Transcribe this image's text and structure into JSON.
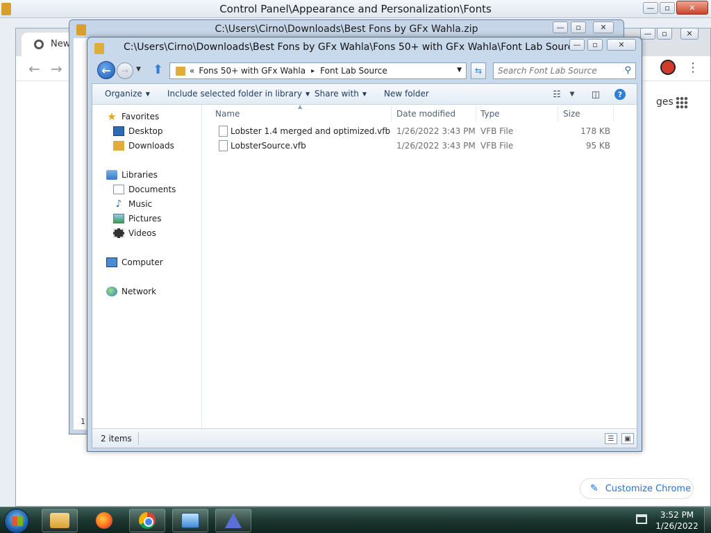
{
  "control_panel": {
    "title": "Control Panel\\Appearance and Personalization\\Fonts"
  },
  "chrome": {
    "tab_label": "New",
    "customize_label": "Customize Chrome",
    "images_label": "ges",
    "status_stub": "1"
  },
  "zip_window": {
    "title": "C:\\Users\\Cirno\\Downloads\\Best Fons by GFx Wahla.zip"
  },
  "explorer": {
    "title": "C:\\Users\\Cirno\\Downloads\\Best Fons by GFx Wahla\\Fons 50+ with GFx Wahla\\Font Lab Source",
    "address": {
      "overflow": "«",
      "segments": [
        "Fons 50+ with GFx Wahla",
        "Font Lab Source"
      ]
    },
    "search_placeholder": "Search Font Lab Source",
    "toolbar": {
      "organize": "Organize",
      "include": "Include selected folder in library",
      "share": "Share with",
      "new_folder": "New folder"
    },
    "nav": {
      "favorites": "Favorites",
      "desktop": "Desktop",
      "downloads": "Downloads",
      "libraries": "Libraries",
      "documents": "Documents",
      "music": "Music",
      "pictures": "Pictures",
      "videos": "Videos",
      "computer": "Computer",
      "network": "Network"
    },
    "columns": {
      "name": "Name",
      "date": "Date modified",
      "type": "Type",
      "size": "Size"
    },
    "files": [
      {
        "name": "Lobster 1.4 merged and optimized.vfb",
        "date": "1/26/2022 3:43 PM",
        "type": "VFB File",
        "size": "178 KB"
      },
      {
        "name": "LobsterSource.vfb",
        "date": "1/26/2022 3:43 PM",
        "type": "VFB File",
        "size": "95 KB"
      }
    ],
    "status": {
      "item_count": "2 items"
    }
  },
  "taskbar": {
    "time": "3:52 PM",
    "date": "1/26/2022"
  }
}
